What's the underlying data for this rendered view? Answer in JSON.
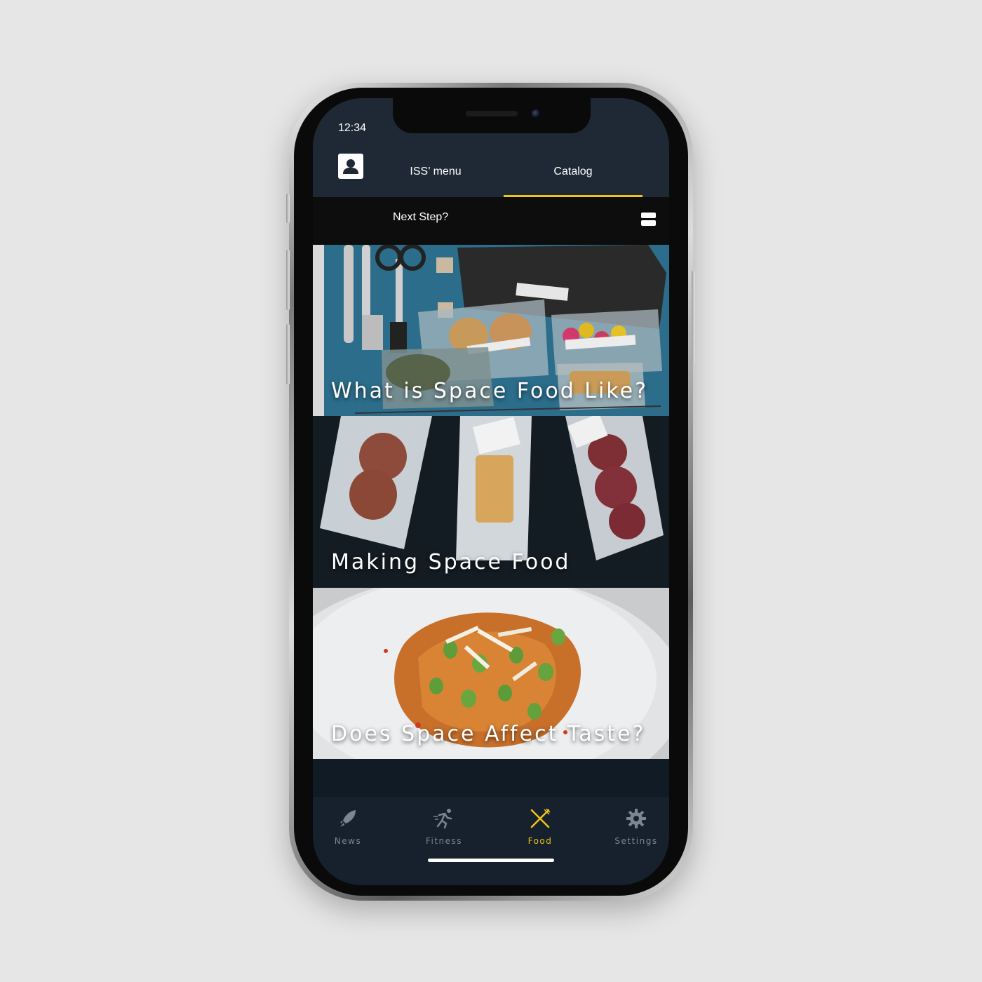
{
  "status": {
    "time": "12:34"
  },
  "header": {
    "tabs": [
      {
        "label": "ISS’ menu",
        "active": false
      },
      {
        "label": "Catalog",
        "active": true
      }
    ],
    "next_step_label": "Next Step?"
  },
  "cards": [
    {
      "title": "What is Space Food Like?"
    },
    {
      "title": "Making Space Food"
    },
    {
      "title": "Does Space Affect Taste?"
    }
  ],
  "bottom_nav": {
    "items": [
      {
        "label": "News",
        "icon": "rocket-icon"
      },
      {
        "label": "Fitness",
        "icon": "running-icon"
      },
      {
        "label": "Food",
        "icon": "fork-knife-icon",
        "active": true
      },
      {
        "label": "Settings",
        "icon": "gear-icon"
      }
    ]
  },
  "colors": {
    "accent": "#f0c419",
    "header_bg": "#1e2935",
    "subbar_bg": "#0d0d0d",
    "nav_bg": "#16212d",
    "nav_inactive": "#7b8692"
  }
}
